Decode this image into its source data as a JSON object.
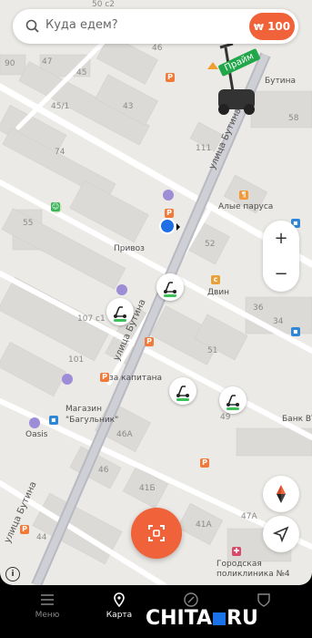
{
  "search": {
    "placeholder": "Куда едем?",
    "balance": "100"
  },
  "promo": {
    "label": "Прайм"
  },
  "map": {
    "house_numbers": [
      "50 с2",
      "90",
      "47",
      "45",
      "46",
      "43",
      "45/1",
      "58",
      "74",
      "111",
      "55",
      "52",
      "107 с1",
      "36",
      "34",
      "101",
      "51",
      "46А",
      "49",
      "41Б",
      "46",
      "41А",
      "47А",
      "44"
    ],
    "streets": [
      "улица Бутина",
      "улица Бутина",
      "улица Бутина"
    ],
    "pois": [
      "Бутина",
      "Алые паруса",
      "Привоз",
      "Двин",
      "за капитана",
      "Магазин \"Багульник\"",
      "Oasis",
      "Банк ВТ",
      "Городская поликлиника №4"
    ]
  },
  "controls": {
    "zoom_in": "+",
    "zoom_out": "−",
    "info": "i"
  },
  "nav": {
    "items": [
      "Меню",
      "Карта",
      "",
      ""
    ],
    "active": "Карта"
  },
  "watermark": {
    "left": "CHITA",
    "right": "RU"
  }
}
